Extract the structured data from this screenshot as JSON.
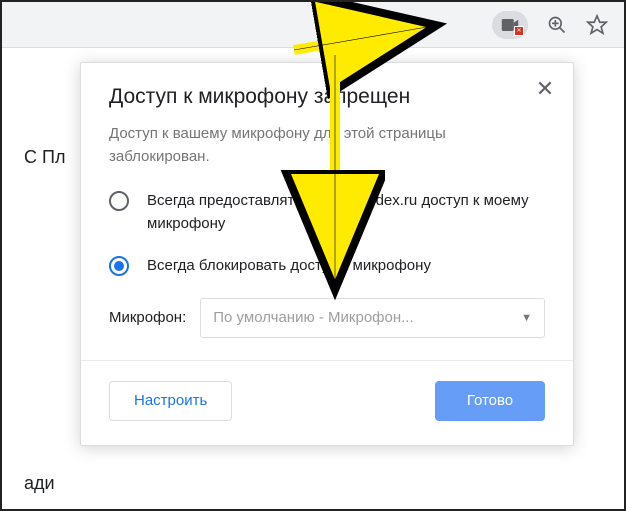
{
  "toolbar": {
    "camera_blocked": true
  },
  "page": {
    "bg_text_1": "С Пл",
    "bg_text_2": "ади"
  },
  "popup": {
    "title": "Доступ к микрофону запрещен",
    "subtitle": "Доступ к вашему микрофону для этой страницы заблокирован.",
    "options": [
      {
        "label": "Всегда предоставлять https://yandex.ru доступ к моему микрофону",
        "selected": false
      },
      {
        "label": "Всегда блокировать доступ к микрофону",
        "selected": true
      }
    ],
    "dropdown_label": "Микрофон:",
    "dropdown_value": "По умолчанию - Микрофон...",
    "manage_button": "Настроить",
    "done_button": "Готово"
  }
}
